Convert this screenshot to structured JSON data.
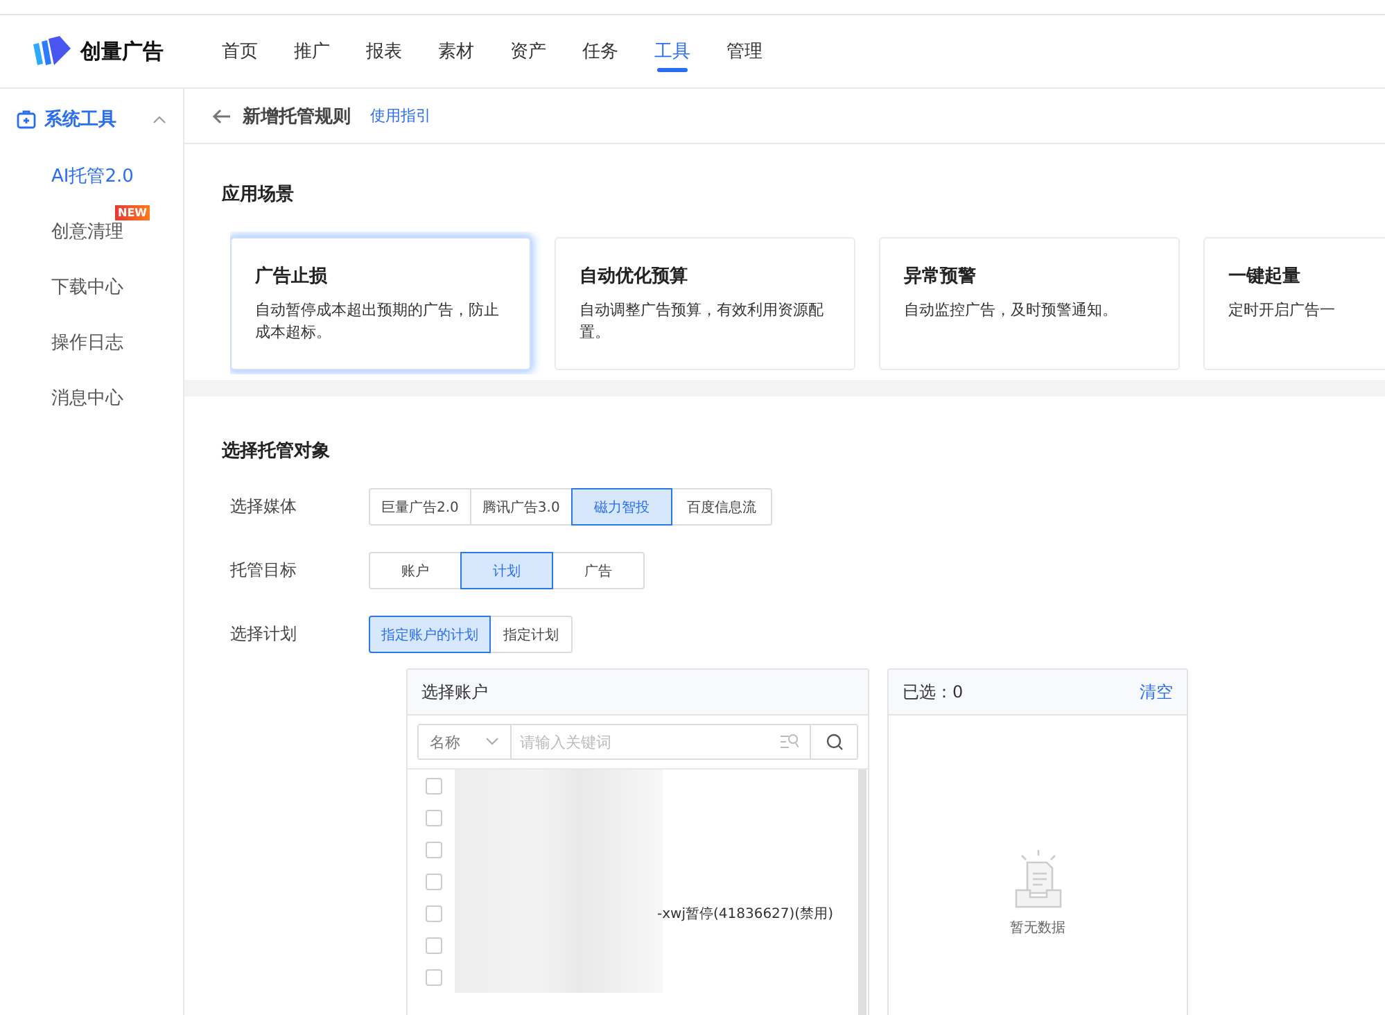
{
  "header": {
    "brand": "创量广告",
    "nav": [
      {
        "label": "首页",
        "selected": false
      },
      {
        "label": "推广",
        "selected": false
      },
      {
        "label": "报表",
        "selected": false
      },
      {
        "label": "素材",
        "selected": false
      },
      {
        "label": "资产",
        "selected": false
      },
      {
        "label": "任务",
        "selected": false
      },
      {
        "label": "工具",
        "selected": true
      },
      {
        "label": "管理",
        "selected": false
      }
    ]
  },
  "sidebar": {
    "group": {
      "label": "系统工具",
      "expanded": true
    },
    "items": [
      {
        "label": "AI托管2.0",
        "selected": true
      },
      {
        "label": "创意清理",
        "selected": false,
        "badge": "NEW"
      },
      {
        "label": "下载中心",
        "selected": false
      },
      {
        "label": "操作日志",
        "selected": false
      },
      {
        "label": "消息中心",
        "selected": false
      }
    ]
  },
  "page": {
    "title": "新增托管规则",
    "guide_link": "使用指引"
  },
  "scenarios": {
    "heading": "应用场景",
    "cards": [
      {
        "title": "广告止损",
        "description": "自动暂停成本超出预期的广告，防止成本超标。",
        "selected": true
      },
      {
        "title": "自动优化预算",
        "description": "自动调整广告预算，有效利用资源配置。",
        "selected": false
      },
      {
        "title": "异常预警",
        "description": "自动监控广告，及时预警通知。",
        "selected": false
      },
      {
        "title": "一键起量",
        "description": "定时开启广告一",
        "selected": false
      }
    ]
  },
  "target": {
    "heading": "选择托管对象",
    "fields": [
      {
        "label": "选择媒体",
        "options": [
          {
            "label": "巨量广告2.0",
            "selected": false
          },
          {
            "label": "腾讯广告3.0",
            "selected": false
          },
          {
            "label": "磁力智投",
            "selected": true
          },
          {
            "label": "百度信息流",
            "selected": false
          }
        ]
      },
      {
        "label": "托管目标",
        "options": [
          {
            "label": "账户",
            "selected": false
          },
          {
            "label": "计划",
            "selected": true
          },
          {
            "label": "广告",
            "selected": false
          }
        ]
      },
      {
        "label": "选择计划",
        "options": [
          {
            "label": "指定账户的计划",
            "selected": true
          },
          {
            "label": "指定计划",
            "selected": false
          }
        ]
      }
    ]
  },
  "account_picker": {
    "title": "选择账户",
    "filter": "名称",
    "search": {
      "placeholder": "请输入关键词"
    },
    "rows": [
      {
        "checked": false
      },
      {
        "checked": false
      },
      {
        "checked": false
      },
      {
        "checked": false
      },
      {
        "checked": false,
        "name": "-xwj暂停(41836627)(禁用)"
      },
      {
        "checked": false
      },
      {
        "checked": false
      }
    ]
  },
  "selected_panel": {
    "count_label": "已选：0",
    "clear": "清空",
    "empty": "暂无数据"
  }
}
